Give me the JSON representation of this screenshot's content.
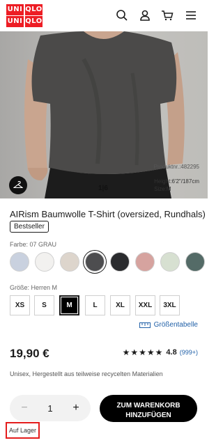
{
  "header": {
    "logo": [
      "UNI",
      "QLO",
      "UNI",
      "QLO"
    ],
    "logo_color": "#ed1d24",
    "icons": [
      "search-icon",
      "account-icon",
      "cart-icon",
      "menu-icon"
    ]
  },
  "gallery": {
    "product_number": "Produktnr.:482295",
    "model_height": "Height:6'2\"/187cm",
    "model_size": "Size:M",
    "pager": "1|6"
  },
  "product": {
    "title": "AIRism Baumwolle T-Shirt (oversized, Rundhals)",
    "badge": "Bestseller",
    "color_label": "Farbe: 07 GRAU",
    "colors": [
      {
        "name": "light-blue",
        "hex": "#c9d1df",
        "selected": false
      },
      {
        "name": "white",
        "hex": "#f2f1ef",
        "selected": false
      },
      {
        "name": "beige",
        "hex": "#ddd5cc",
        "selected": false
      },
      {
        "name": "gray",
        "hex": "#4d4d4f",
        "selected": true
      },
      {
        "name": "black",
        "hex": "#2a2b2e",
        "selected": false
      },
      {
        "name": "pink",
        "hex": "#d6a39f",
        "selected": false
      },
      {
        "name": "light-green",
        "hex": "#d7e0d1",
        "selected": false
      },
      {
        "name": "dark-green",
        "hex": "#546b67",
        "selected": false
      }
    ],
    "size_label": "Größe: Herren M",
    "sizes": [
      "XS",
      "S",
      "M",
      "L",
      "XL",
      "XXL",
      "3XL"
    ],
    "selected_size": "M",
    "size_guide": "Größentabelle",
    "price": "19,90 €",
    "stars": "★★★★★",
    "rating": "4.8",
    "rating_count": "(999+)",
    "info": "Unisex,  Hergestellt aus teilweise recycelten Materialien"
  },
  "purchase": {
    "quantity": "1",
    "minus": "−",
    "plus": "+",
    "cart_line1": "ZUM WARENKORB",
    "cart_line2": "HINZUFÜGEN",
    "stock": "Auf Lager"
  }
}
